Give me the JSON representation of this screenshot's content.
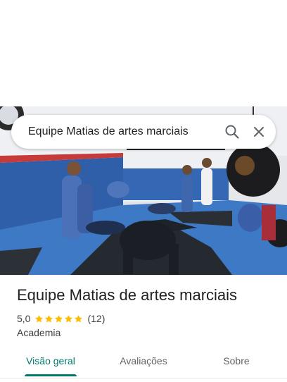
{
  "search": {
    "query": "Equipe Matias de artes marciais"
  },
  "place": {
    "name": "Equipe Matias de artes marciais",
    "rating": "5,0",
    "stars": 5,
    "review_count": "(12)",
    "category": "Academia"
  },
  "tabs": [
    {
      "label": "Visão geral",
      "active": true
    },
    {
      "label": "Avaliações",
      "active": false
    },
    {
      "label": "Sobre",
      "active": false
    }
  ],
  "colors": {
    "accent": "#00796b",
    "star": "#fbbc04",
    "text": "#202124",
    "secondary_text": "#3c4043"
  },
  "icons": {
    "search": "search-icon",
    "close": "close-icon",
    "star": "star-icon"
  }
}
